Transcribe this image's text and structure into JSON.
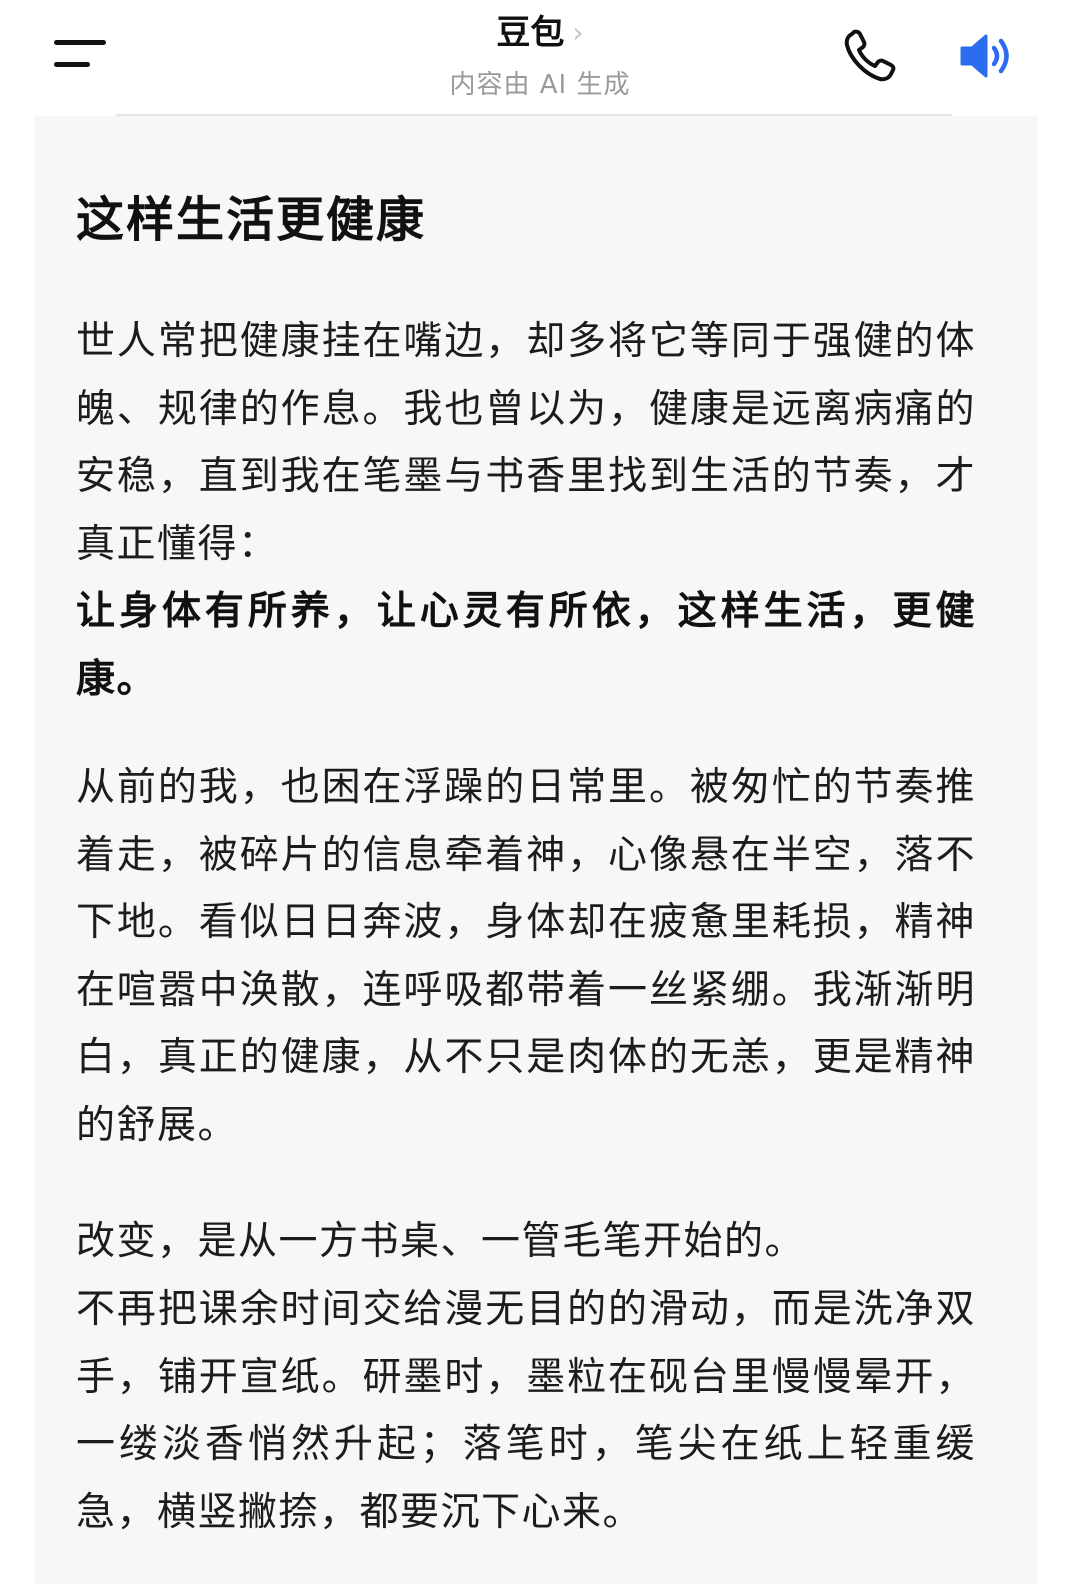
{
  "header": {
    "title": "豆包",
    "title_chevron": "›",
    "subtitle": "内容由 AI 生成",
    "accent_color": "#2b6cf0"
  },
  "icons": {
    "menu": "menu-icon",
    "phone": "phone-icon",
    "speaker": "speaker-icon"
  },
  "article": {
    "title": "这样生活更健康",
    "paragraph1": "世人常把健康挂在嘴边，却多将它等同于强健的体魄、规律的作息。我也曾以为，健康是远离病痛的安稳，直到我在笔墨与书香里找到生活的节奏，才真正懂得：",
    "paragraph1_strong": "让身体有所养，让心灵有所依，这样生活，更健康。",
    "paragraph2": "从前的我，也困在浮躁的日常里。被匆忙的节奏推着走，被碎片的信息牵着神，心像悬在半空，落不下地。看似日日奔波，身体却在疲惫里耗损，精神在喧嚣中涣散，连呼吸都带着一丝紧绷。我渐渐明白，真正的健康，从不只是肉体的无恙，更是精神的舒展。",
    "paragraph3_lead": "改变，是从一方书桌、一管毛笔开始的。",
    "paragraph3": "不再把课余时间交给漫无目的的滑动，而是洗净双手，铺开宣纸。研墨时，墨粒在砚台里慢慢晕开，一缕淡香悄然升起；落笔时，笔尖在纸上轻重缓急，横竖撇捺，都要沉下心来。"
  }
}
